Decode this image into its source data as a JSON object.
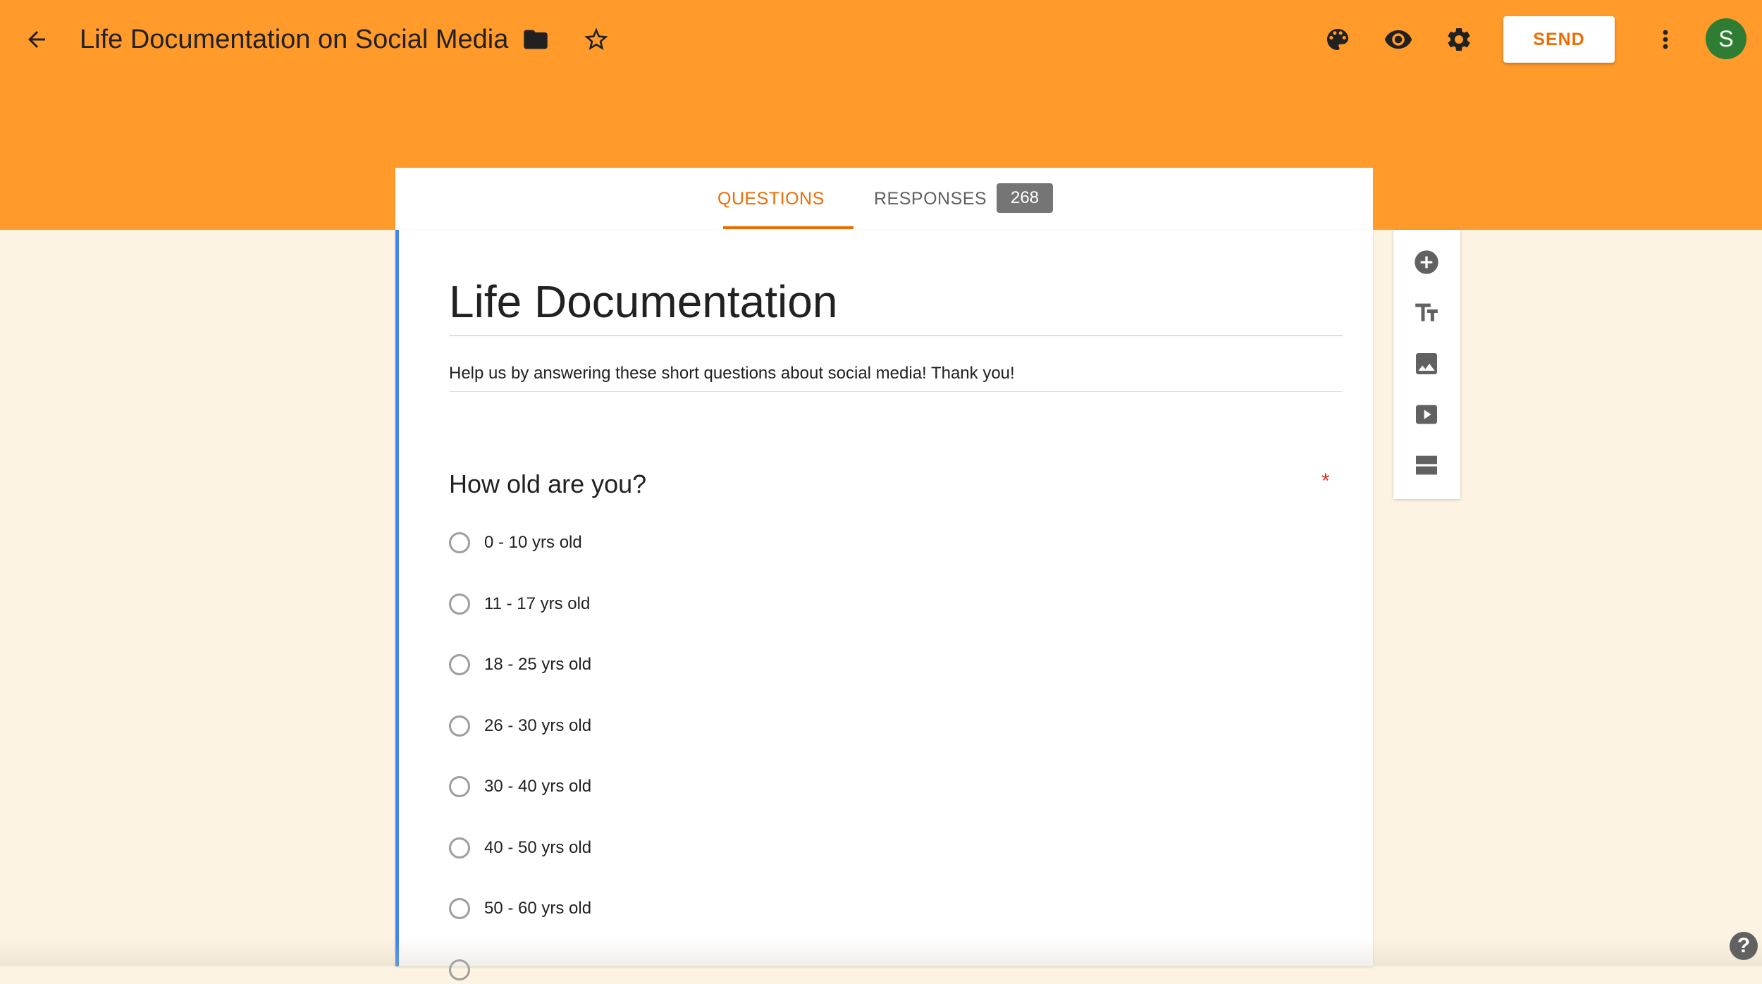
{
  "header": {
    "doc_title": "Life Documentation on Social Media",
    "send_label": "SEND",
    "avatar_letter": "S",
    "accent_color": "#ff9a2b",
    "icons": [
      "arrow-back-icon",
      "folder-icon",
      "star-outline-icon",
      "palette-icon",
      "eye-icon",
      "gear-icon",
      "more-vert-icon"
    ]
  },
  "tabs": {
    "questions_label": "QUESTIONS",
    "responses_label": "RESPONSES",
    "responses_count": "268"
  },
  "form": {
    "title": "Life Documentation",
    "description": "Help us by answering these short questions about social media! Thank you!",
    "question": {
      "text": "How old are you?",
      "required_mark": "*",
      "options": [
        "0 - 10 yrs old",
        "11 - 17 yrs old",
        "18 - 25 yrs old",
        "26 - 30 yrs old",
        "30 - 40 yrs old",
        "40 - 50 yrs old",
        "50 - 60 yrs old"
      ]
    }
  },
  "toolbar": {
    "icons": [
      "add-question-icon",
      "title-text-icon",
      "image-icon",
      "video-icon",
      "section-icon"
    ]
  },
  "help": {
    "label": "?"
  }
}
